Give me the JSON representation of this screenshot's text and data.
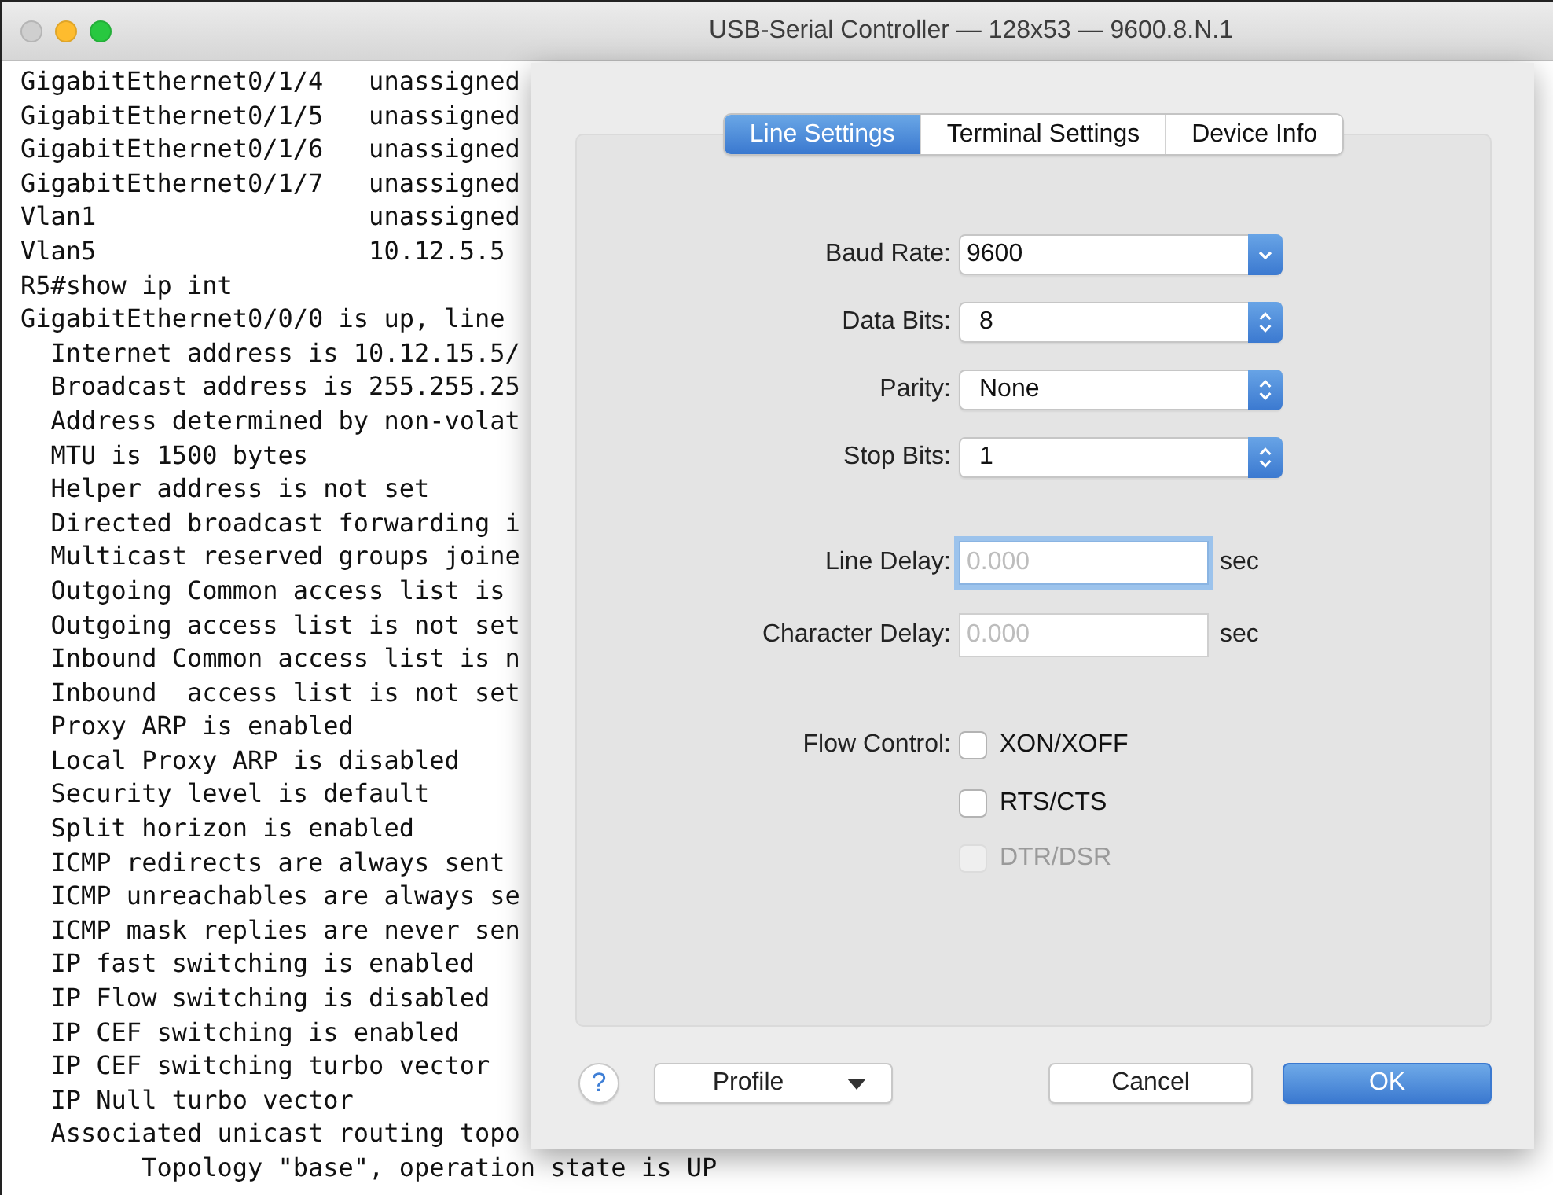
{
  "window": {
    "title": "USB-Serial Controller — 128x53 — 9600.8.N.1"
  },
  "terminal": {
    "lines": [
      "GigabitEthernet0/1/4   unassigned",
      "GigabitEthernet0/1/5   unassigned",
      "GigabitEthernet0/1/6   unassigned",
      "GigabitEthernet0/1/7   unassigned",
      "Vlan1                  unassigned",
      "Vlan5                  10.12.5.5",
      "R5#show ip int",
      "GigabitEthernet0/0/0 is up, line",
      "  Internet address is 10.12.15.5/",
      "  Broadcast address is 255.255.25",
      "  Address determined by non-volat",
      "  MTU is 1500 bytes",
      "  Helper address is not set",
      "  Directed broadcast forwarding i",
      "  Multicast reserved groups joine",
      "  Outgoing Common access list is",
      "  Outgoing access list is not set",
      "  Inbound Common access list is n",
      "  Inbound  access list is not set",
      "  Proxy ARP is enabled",
      "  Local Proxy ARP is disabled",
      "  Security level is default",
      "  Split horizon is enabled",
      "  ICMP redirects are always sent",
      "  ICMP unreachables are always se",
      "  ICMP mask replies are never sen",
      "  IP fast switching is enabled",
      "  IP Flow switching is disabled",
      "  IP CEF switching is enabled",
      "  IP CEF switching turbo vector",
      "  IP Null turbo vector",
      "  Associated unicast routing topo",
      "        Topology \"base\", operation state is UP"
    ]
  },
  "dialog": {
    "tabs": [
      {
        "label": "Line Settings",
        "selected": true
      },
      {
        "label": "Terminal Settings",
        "selected": false
      },
      {
        "label": "Device Info",
        "selected": false
      }
    ],
    "fields": [
      {
        "kind": "combo",
        "label": "Baud Rate:",
        "value": "9600"
      },
      {
        "kind": "popup",
        "label": "Data Bits:",
        "value": "8"
      },
      {
        "kind": "popup",
        "label": "Parity:",
        "value": "None"
      },
      {
        "kind": "popup",
        "label": "Stop Bits:",
        "value": "1"
      },
      {
        "kind": "text",
        "label": "Line Delay:",
        "placeholder": "0.000",
        "unit": "sec",
        "focused": true
      },
      {
        "kind": "text",
        "label": "Character Delay:",
        "placeholder": "0.000",
        "unit": "sec",
        "focused": false
      }
    ],
    "flow_control": {
      "label": "Flow Control:",
      "options": [
        {
          "label": "XON/XOFF",
          "checked": false,
          "disabled": false
        },
        {
          "label": "RTS/CTS",
          "checked": false,
          "disabled": false
        },
        {
          "label": "DTR/DSR",
          "checked": false,
          "disabled": true
        }
      ]
    },
    "help_button": {
      "label": "?"
    },
    "profile_button": {
      "label": "Profile"
    },
    "buttons": [
      {
        "label": "Cancel",
        "default": false
      },
      {
        "label": "OK",
        "default": true
      }
    ]
  }
}
